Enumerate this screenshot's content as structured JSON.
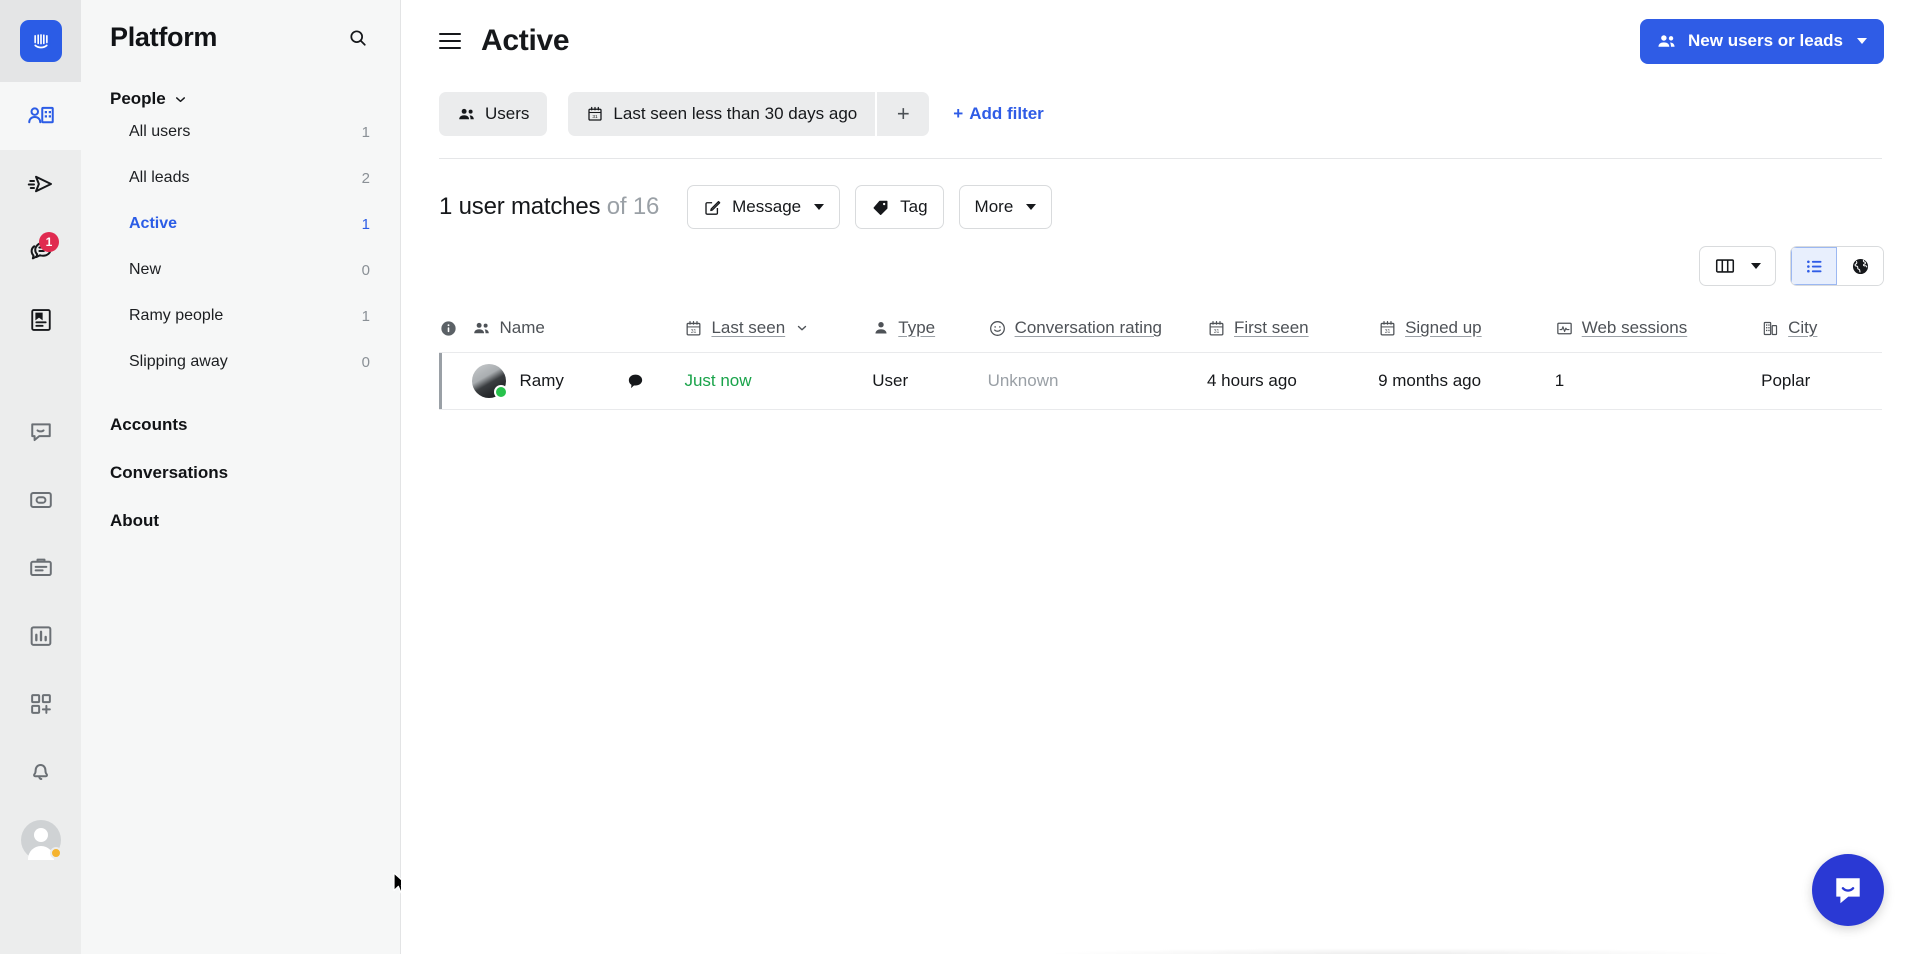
{
  "app": {
    "brand_color": "#2b5ce6",
    "logo_icon": "intercom-logo-icon"
  },
  "rail": {
    "items": [
      {
        "icon": "people-building-icon",
        "name": "people",
        "active": true,
        "badge": ""
      },
      {
        "icon": "paper-plane-outbound-icon",
        "name": "outbound",
        "active": false,
        "badge": ""
      },
      {
        "icon": "conversations-inbox-icon",
        "name": "inbox",
        "active": false,
        "badge": "1"
      },
      {
        "icon": "articles-document-icon",
        "name": "articles",
        "active": false,
        "badge": ""
      },
      {
        "icon": "messenger-chat-icon",
        "name": "messenger",
        "active": false,
        "badge": ""
      },
      {
        "icon": "card-stack-icon",
        "name": "cards",
        "active": false,
        "badge": ""
      },
      {
        "icon": "clipboard-notes-icon",
        "name": "clipboard",
        "active": false,
        "badge": ""
      },
      {
        "icon": "bar-chart-reports-icon",
        "name": "reports",
        "active": false,
        "badge": ""
      },
      {
        "icon": "apps-grid-plus-icon",
        "name": "apps",
        "active": false,
        "badge": ""
      },
      {
        "icon": "bell-notifications-icon",
        "name": "notifications",
        "active": false,
        "badge": ""
      }
    ],
    "account_avatar_status_color": "#f5b32e"
  },
  "sidebar": {
    "title": "Platform",
    "search_icon": "search-icon",
    "section": {
      "label": "People",
      "chevron": "chevron-down-icon"
    },
    "items": [
      {
        "label": "All users",
        "count": "1",
        "selected": false
      },
      {
        "label": "All leads",
        "count": "2",
        "selected": false
      },
      {
        "label": "Active",
        "count": "1",
        "selected": true
      },
      {
        "label": "New",
        "count": "0",
        "selected": false
      },
      {
        "label": "Ramy people",
        "count": "1",
        "selected": false
      },
      {
        "label": "Slipping away",
        "count": "0",
        "selected": false
      }
    ],
    "links": [
      {
        "label": "Accounts"
      },
      {
        "label": "Conversations"
      },
      {
        "label": "About"
      }
    ]
  },
  "topbar": {
    "menu_icon": "hamburger-menu-icon",
    "title": "Active",
    "new_button": {
      "label": "New users or leads",
      "icon": "people-icon",
      "caret": "chevron-down-icon"
    }
  },
  "filters": {
    "type_chip": {
      "label": "Users",
      "icon": "people-icon"
    },
    "condition_chip": {
      "label": "Last seen less than 30 days ago",
      "icon": "calendar-icon"
    },
    "add_condition_label": "+",
    "add_filter_label": "Add filter",
    "add_filter_plus": "+"
  },
  "actions": {
    "matches_count": "1 user matches",
    "matches_total": "of 16",
    "message_button": {
      "label": "Message",
      "icon": "compose-pencil-icon"
    },
    "tag_button": {
      "label": "Tag",
      "icon": "tag-icon"
    },
    "more_button": {
      "label": "More"
    }
  },
  "view_controls": {
    "columns_button": {
      "icon": "columns-icon",
      "caret": "chevron-down-icon"
    },
    "list_view": {
      "icon": "list-view-icon",
      "active": true
    },
    "map_view": {
      "icon": "globe-map-icon",
      "active": false
    }
  },
  "table": {
    "columns": [
      {
        "key": "info",
        "label": "",
        "icon": "info-circle-icon",
        "sortable": false
      },
      {
        "key": "name",
        "label": "Name",
        "icon": "people-icon",
        "sortable": false
      },
      {
        "key": "chat",
        "label": "",
        "icon": "",
        "sortable": false
      },
      {
        "key": "last_seen",
        "label": "Last seen",
        "icon": "calendar-icon",
        "sortable": true,
        "sorted": true,
        "sort_icon": "chevron-down-icon"
      },
      {
        "key": "type",
        "label": "Type",
        "icon": "person-icon",
        "sortable": true
      },
      {
        "key": "conversation_rating",
        "label": "Conversation rating",
        "icon": "smiley-icon",
        "sortable": true
      },
      {
        "key": "first_seen",
        "label": "First seen",
        "icon": "calendar-icon",
        "sortable": true
      },
      {
        "key": "signed_up",
        "label": "Signed up",
        "icon": "calendar-icon",
        "sortable": true
      },
      {
        "key": "web_sessions",
        "label": "Web sessions",
        "icon": "activity-graph-icon",
        "sortable": true
      },
      {
        "key": "city",
        "label": "City",
        "icon": "building-icon",
        "sortable": true
      }
    ],
    "rows": [
      {
        "name": "Ramy",
        "avatar": "user-photo-avatar",
        "online": true,
        "chat_icon": "chat-bubble-icon",
        "last_seen": "Just now",
        "last_seen_color": "#19a34a",
        "type": "User",
        "conversation_rating": "Unknown",
        "first_seen": "4 hours ago",
        "signed_up": "9 months ago",
        "web_sessions": "1",
        "city": "Poplar"
      }
    ]
  },
  "messenger_launcher": {
    "icon": "intercom-messenger-icon",
    "color": "#2a39d4"
  }
}
